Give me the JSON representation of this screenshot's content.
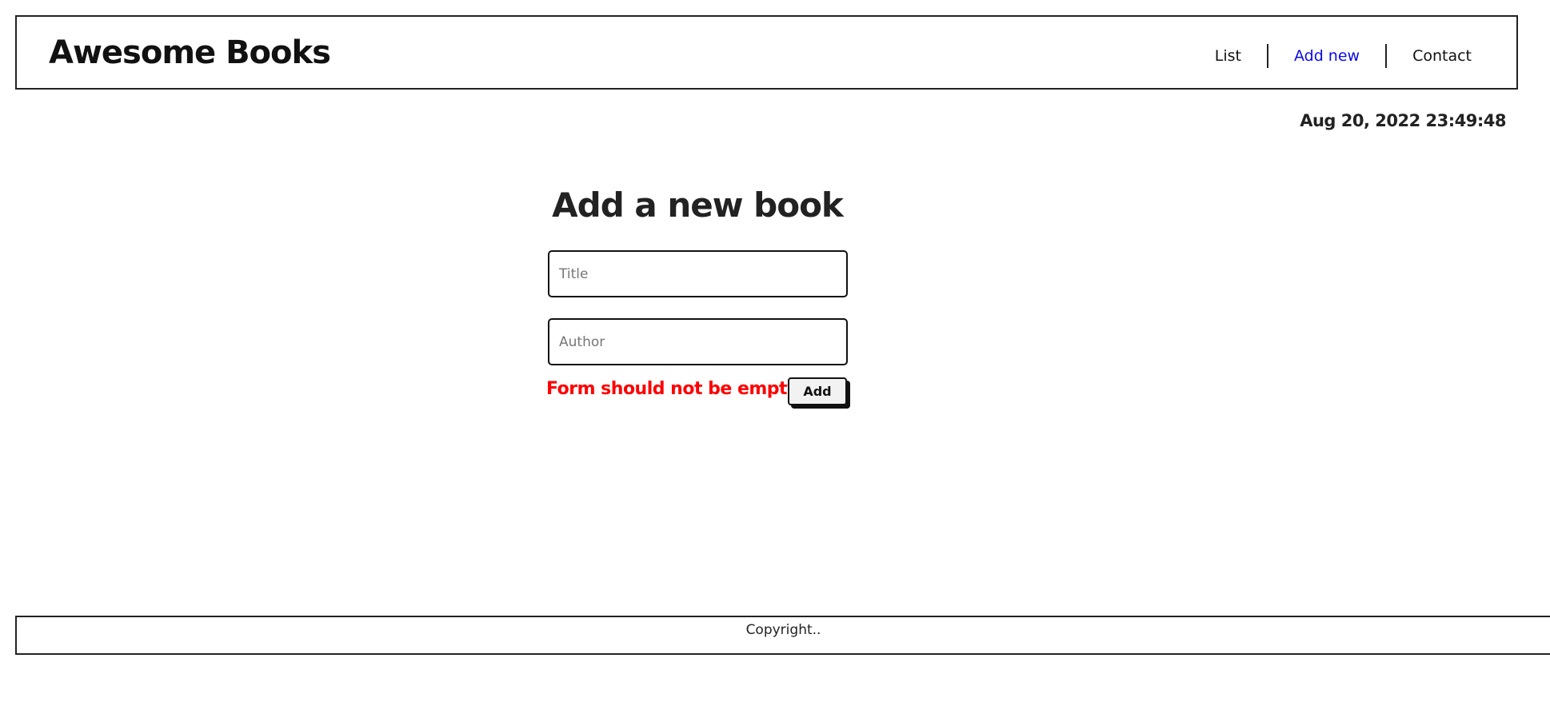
{
  "header": {
    "brand": "Awesome Books",
    "nav": {
      "list": "List",
      "add_new": "Add new",
      "contact": "Contact"
    },
    "active_color": "#0a0ae6"
  },
  "datetime": "Aug 20, 2022 23:49:48",
  "form": {
    "heading": "Add a new book",
    "title_placeholder": "Title",
    "author_placeholder": "Author",
    "title_value": "",
    "author_value": "",
    "error": "Form should not be empty",
    "error_color": "#ff0000",
    "add_label": "Add"
  },
  "footer": {
    "text": "Copyright.."
  }
}
